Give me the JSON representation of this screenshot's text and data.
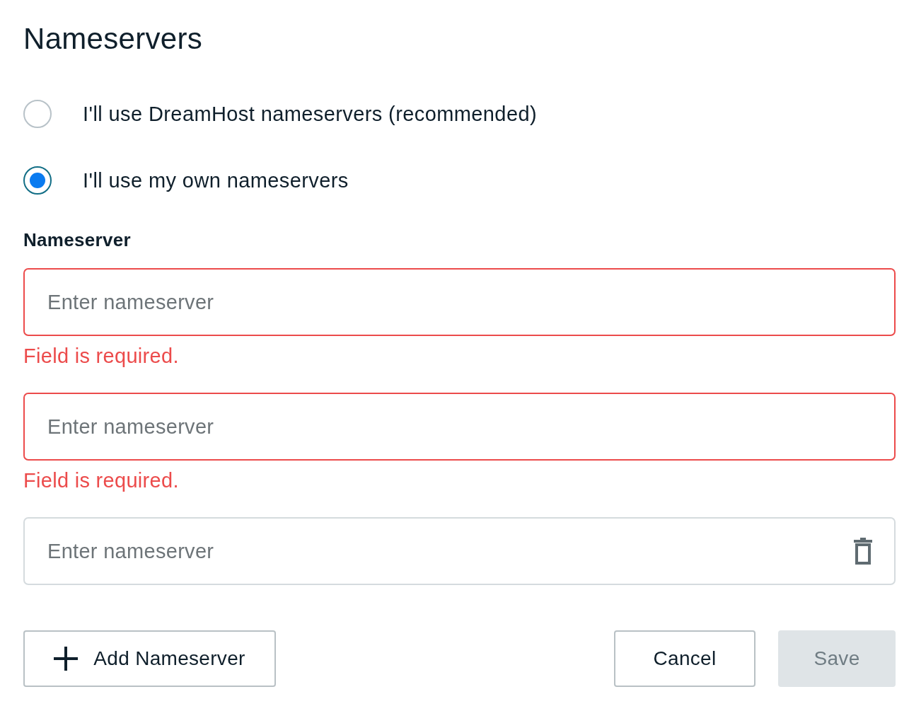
{
  "title": "Nameservers",
  "options": [
    {
      "label": "I'll use DreamHost nameservers (recommended)",
      "selected": false
    },
    {
      "label": "I'll use my own nameservers",
      "selected": true
    }
  ],
  "field_label": "Nameserver",
  "fields": [
    {
      "placeholder": "Enter nameserver",
      "invalid": true,
      "error": "Field is required.",
      "removable": false
    },
    {
      "placeholder": "Enter nameserver",
      "invalid": true,
      "error": "Field is required.",
      "removable": false
    },
    {
      "placeholder": "Enter nameserver",
      "invalid": false,
      "removable": true
    }
  ],
  "buttons": [
    {
      "kind": "add",
      "label": "Add Nameserver",
      "disabled": false
    },
    {
      "kind": "secondary",
      "label": "Cancel",
      "disabled": false
    },
    {
      "kind": "primary",
      "label": "Save",
      "disabled": true
    }
  ]
}
